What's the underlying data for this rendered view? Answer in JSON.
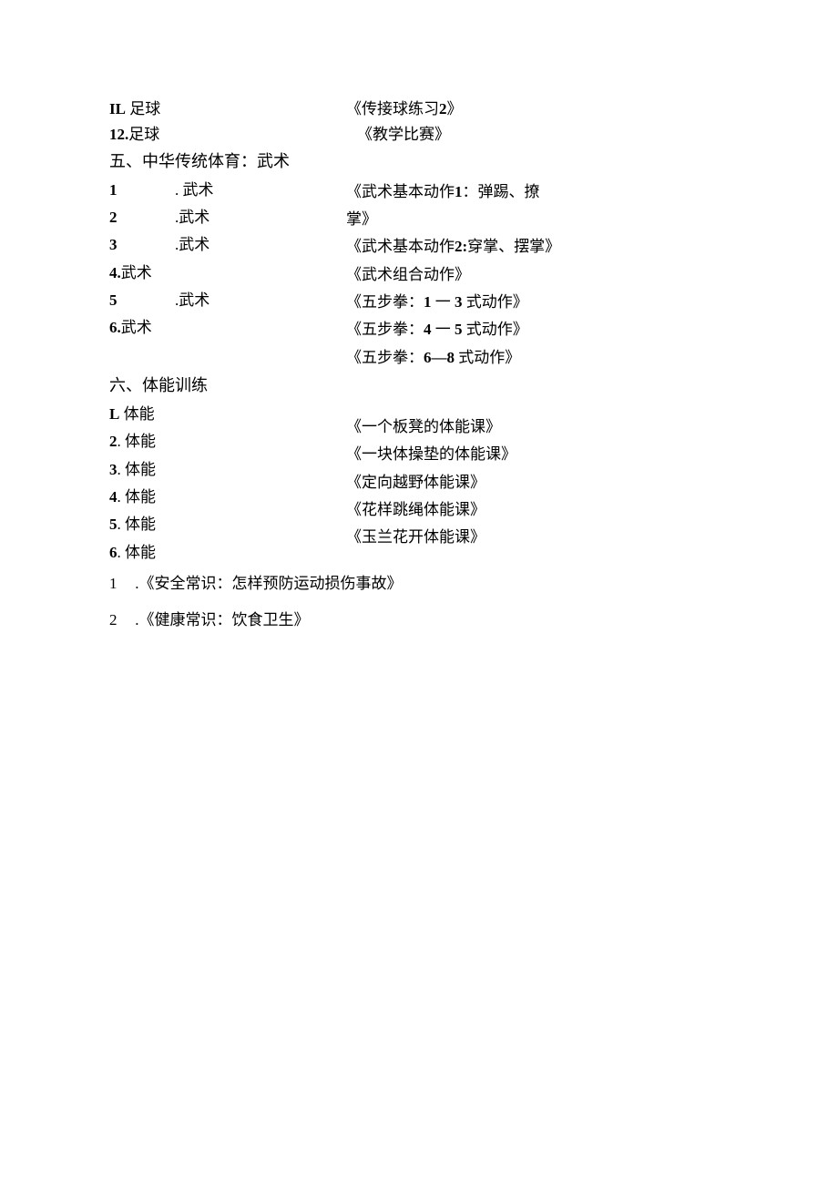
{
  "top": {
    "row1_left_prefix": "IL",
    "row1_left_rest": " 足球",
    "row1_right_a": "《传接球练习",
    "row1_right_b": "2",
    "row1_right_c": "》",
    "row2_left_prefix": "12.",
    "row2_left_rest": "足球",
    "row2_right": "《教学比赛》"
  },
  "sec5_title": "五、中华传统体育：武术",
  "sec5_left": {
    "i1_num": "1",
    "i1_label": ". 武术",
    "i2_num": "2",
    "i2_label": ".武术",
    "i3_num": "3",
    "i3_label": ".武术",
    "i4_num": "4.",
    "i4_label": "武术",
    "i5_num": "5",
    "i5_label": ".武术",
    "i6_num": "6.",
    "i6_label": "武术"
  },
  "sec5_right": {
    "r1a": "《武术基本动作",
    "r1b": "1",
    "r1c": "：弹踢、撩",
    "r1d": "掌》",
    "r2a": "《武术基本动作",
    "r2b": "2:",
    "r2c": "穿掌、摆掌》",
    "r3": "《武术组合动作》",
    "r4a": "《五步拳：",
    "r4b": "1",
    "r4c": " 一 ",
    "r4d": "3",
    "r4e": " 式动作》",
    "r5a": "《五步拳：",
    "r5b": "4",
    "r5c": " 一 ",
    "r5d": "5",
    "r5e": " 式动作》",
    "r6a": "《五步拳：",
    "r6b": "6—8",
    "r6c": " 式动作》"
  },
  "sec6_title": "六、体能训练",
  "sec6_left": {
    "i1_num": "L",
    "i1_label": " 体能",
    "i2_num": "2",
    "i2_label": ". 体能",
    "i3_num": "3",
    "i3_label": ". 体能",
    "i4_num": "4",
    "i4_label": ". 体能",
    "i5_num": "5",
    "i5_label": ". 体能",
    "i6_num": "6",
    "i6_label": ". 体能"
  },
  "sec6_right": {
    "r1": "《一个板凳的体能课》",
    "r2": "《一块体操垫的体能课》",
    "r3": "《定向越野体能课》",
    "r4": "《花样跳绳体能课》",
    "r5": "《玉兰花开体能课》"
  },
  "bottom": {
    "b1_num": "1",
    "b1_text": " .《安全常识：怎样预防运动损伤事故》",
    "b2_num": "2",
    "b2_text": " .《健康常识：饮食卫生》"
  }
}
